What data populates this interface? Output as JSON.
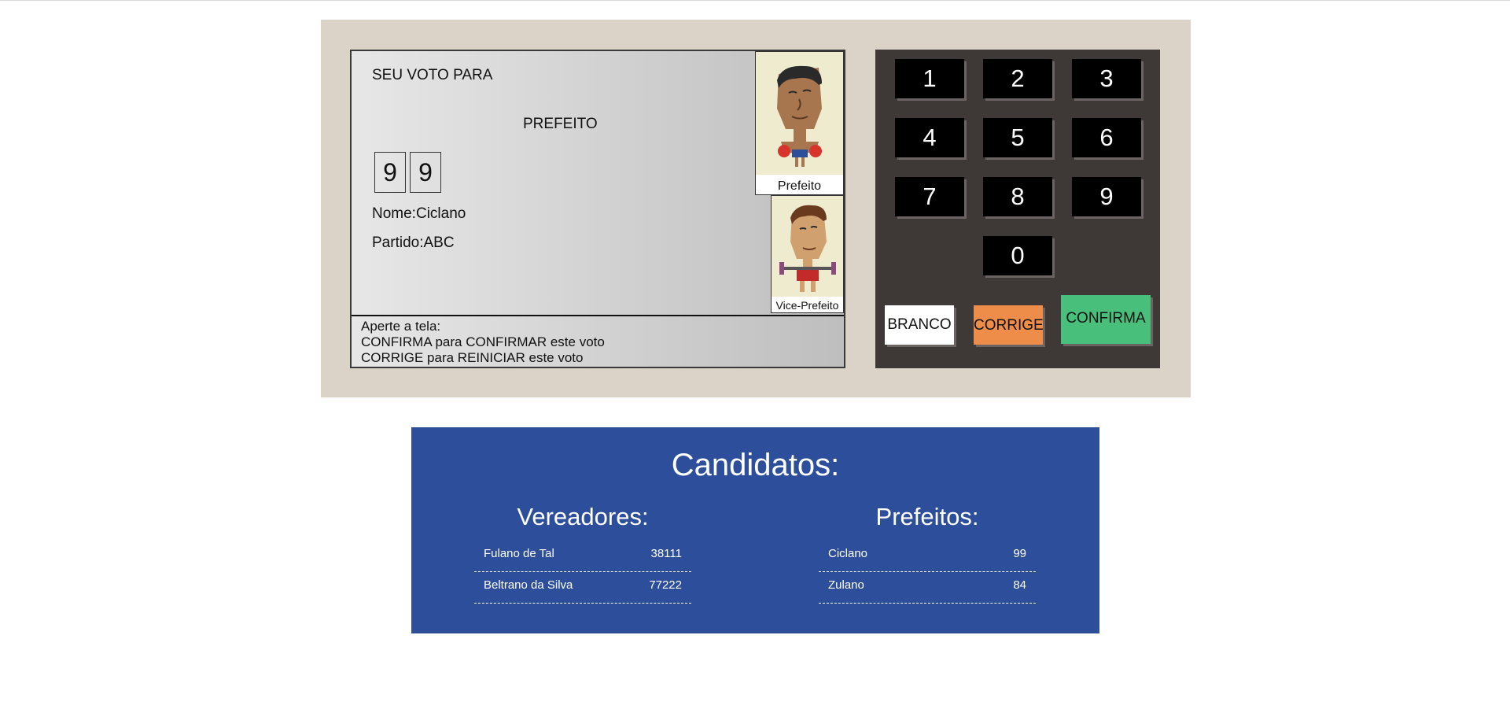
{
  "screen": {
    "header": "SEU VOTO PARA",
    "office": "PREFEITO",
    "digits": [
      "9",
      "9"
    ],
    "name_label": "Nome:",
    "name_value": "Ciclano",
    "party_label": "Partido:",
    "party_value": "ABC",
    "photos": {
      "main_label": "Prefeito",
      "vice_label": "Vice-Prefeito"
    },
    "instructions": [
      "Aperte a tela:",
      "CONFIRMA para CONFIRMAR este voto",
      "CORRIGE para REINICIAR este voto"
    ]
  },
  "keypad": {
    "keys": [
      "1",
      "2",
      "3",
      "4",
      "5",
      "6",
      "7",
      "8",
      "9",
      "0"
    ],
    "branco": "BRANCO",
    "corrige": "CORRIGE",
    "confirma": "CONFIRMA"
  },
  "candidates": {
    "title": "Candidatos:",
    "vereadores": {
      "title": "Vereadores:",
      "rows": [
        {
          "name": "Fulano de Tal",
          "number": "38111"
        },
        {
          "name": "Beltrano da Silva",
          "number": "77222"
        }
      ]
    },
    "prefeitos": {
      "title": "Prefeitos:",
      "rows": [
        {
          "name": "Ciclano",
          "number": "99"
        },
        {
          "name": "Zulano",
          "number": "84"
        }
      ]
    }
  },
  "colors": {
    "urna_body": "#dbd3c8",
    "keypad_bg": "#3e3837",
    "key_bg": "#000000",
    "branco": "#ffffff",
    "corrige": "#ee8d49",
    "confirma": "#48c07b",
    "candidates_bg": "#2c4e9b"
  }
}
